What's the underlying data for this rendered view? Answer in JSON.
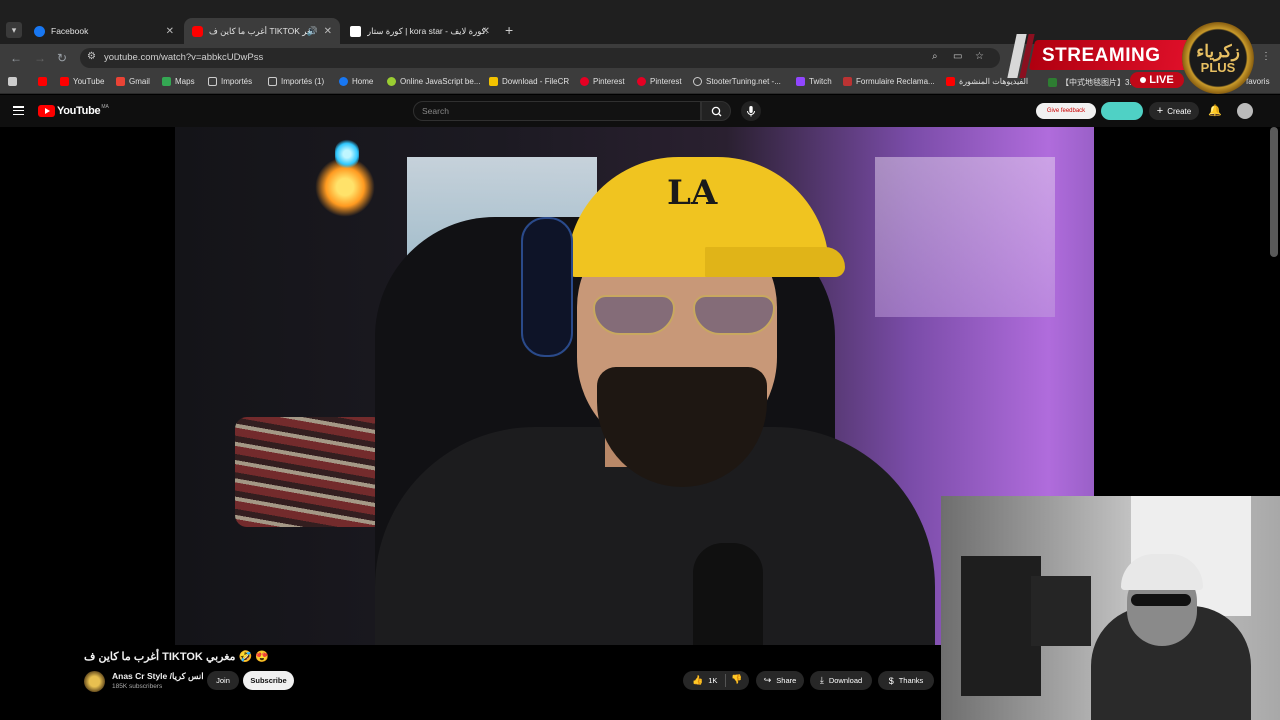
{
  "browser": {
    "tabs": [
      {
        "label": "Facebook",
        "active": false,
        "favicon_color": "#1877f2"
      },
      {
        "label": "أغرب ما كاين ف TIKTOK مغر...",
        "active": true,
        "favicon_color": "#ff0000"
      },
      {
        "label": "كورة ستار | kora star - كورة لايف...",
        "active": false,
        "favicon_color": "#ffffff"
      }
    ],
    "url": "youtube.com/watch?v=abbkcUDwPss",
    "bookmarks": [
      {
        "label": "YouTube",
        "icon": "youtube-icon"
      },
      {
        "label": "Gmail",
        "icon": "gmail-icon"
      },
      {
        "label": "Maps",
        "icon": "maps-icon"
      },
      {
        "label": "Importés",
        "icon": "folder-icon"
      },
      {
        "label": "Importés (1)",
        "icon": "folder-icon"
      },
      {
        "label": "Home",
        "icon": "facebook-icon"
      },
      {
        "label": "Online JavaScript be...",
        "icon": "js-icon"
      },
      {
        "label": "Download - FileCR",
        "icon": "filecr-icon"
      },
      {
        "label": "Pinterest",
        "icon": "pinterest-icon"
      },
      {
        "label": "Pinterest",
        "icon": "pinterest-icon"
      },
      {
        "label": "StooterTuning.net -...",
        "icon": "web-icon"
      },
      {
        "label": "Twitch",
        "icon": "twitch-icon"
      },
      {
        "label": "Formulaire Reclama...",
        "icon": "form-icon"
      },
      {
        "label": "الفيديوهات المنشورة",
        "icon": "youtube-icon"
      },
      {
        "label": "【中式地毯图片】3...",
        "icon": "web-icon"
      },
      {
        "label": "favoris",
        "icon": "folder-icon"
      }
    ]
  },
  "overlay": {
    "streaming_label": "STREAMING",
    "live_label": "LIVE",
    "logo_text_ar": "زكرياء",
    "logo_text_plus": "PLUS"
  },
  "youtube": {
    "logo_label": "YouTube",
    "region": "MA",
    "search_placeholder": "Search",
    "feedback_label": "Give feedback",
    "create_label": "Create"
  },
  "video": {
    "title": "أغرب ما كاين ف TIKTOK مغربي 🤣 😍",
    "channel_name": "Anas Cr Style /انس كريا",
    "subscribers": "185K subscribers",
    "join_label": "Join",
    "subscribe_label": "Subscribe",
    "likes": "1K",
    "share_label": "Share",
    "download_label": "Download",
    "thanks_label": "Thanks",
    "cap_text": "LA"
  },
  "colors": {
    "yt_red": "#ff0000",
    "stream_red": "#d8102a",
    "logo_gold": "#e8c062"
  }
}
